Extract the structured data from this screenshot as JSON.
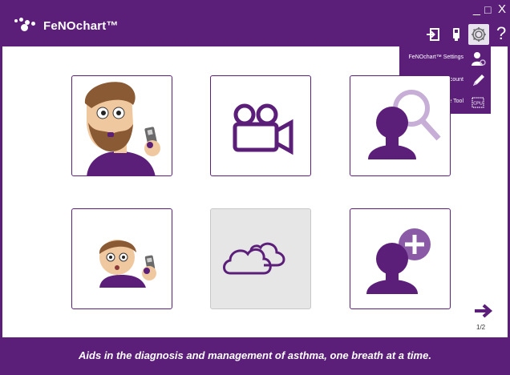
{
  "app": {
    "title": "FeNOchart™"
  },
  "window_controls": {
    "minimize": "_",
    "maximize": "□",
    "close": "X"
  },
  "toolbar": {
    "icons": [
      "exit-icon",
      "device-icon",
      "gear-icon",
      "help-icon"
    ],
    "help_label": "?"
  },
  "settings_menu": {
    "items": [
      {
        "label": "FeNOchart™ Settings",
        "icon": "user-settings-icon"
      },
      {
        "label": "Edit My Account",
        "icon": "pencil-icon"
      },
      {
        "label": "Firmware Update Tool",
        "icon": "cpu-icon"
      }
    ],
    "cpu_text": "CPU"
  },
  "tiles": [
    {
      "name": "adult-test",
      "icon": "adult-with-device-icon",
      "enabled": true
    },
    {
      "name": "video",
      "icon": "video-camera-icon",
      "enabled": true
    },
    {
      "name": "patient-search",
      "icon": "patient-search-icon",
      "enabled": true
    },
    {
      "name": "child-test",
      "icon": "child-with-device-icon",
      "enabled": true
    },
    {
      "name": "cloud",
      "icon": "cloud-icon",
      "enabled": false
    },
    {
      "name": "add-patient",
      "icon": "add-patient-icon",
      "enabled": true
    }
  ],
  "pagination": {
    "page": "1/2",
    "next_icon": "arrow-right-icon"
  },
  "footer": {
    "tagline": "Aids in the diagnosis and management of asthma, one breath at a time."
  },
  "colors": {
    "brand": "#5b1f7a",
    "accent": "#8a5aa6",
    "disabled": "#e6e6e6"
  }
}
